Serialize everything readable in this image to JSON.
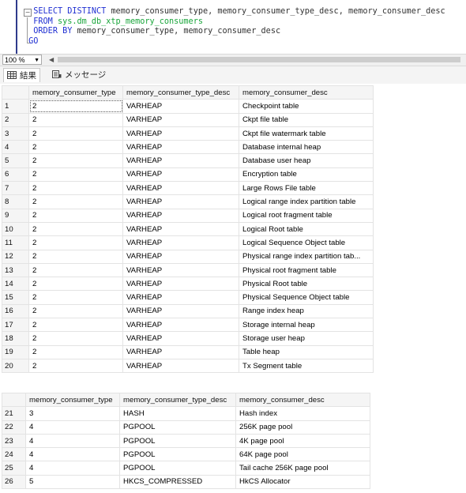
{
  "editor": {
    "line1_kw1": "SELECT DISTINCT ",
    "line1_rest": "memory_consumer_type, memory_consumer_type_desc, memory_consumer_desc",
    "line2_kw": "FROM ",
    "line2_sys": "sys.dm_db_xtp_memory_consumers",
    "line3_kw": "ORDER BY ",
    "line3_rest": "memory_consumer_type, memory_consumer_desc",
    "line4_kw": "GO"
  },
  "zoom": {
    "value": "100 %"
  },
  "tabs": [
    {
      "label": "結果",
      "icon": "grid-icon"
    },
    {
      "label": "メッセージ",
      "icon": "messages-icon"
    }
  ],
  "columns": [
    "memory_consumer_type",
    "memory_consumer_type_desc",
    "memory_consumer_desc"
  ],
  "rows_top": [
    [
      "1",
      "2",
      "VARHEAP",
      "Checkpoint table"
    ],
    [
      "2",
      "2",
      "VARHEAP",
      "Ckpt file table"
    ],
    [
      "3",
      "2",
      "VARHEAP",
      "Ckpt file watermark table"
    ],
    [
      "4",
      "2",
      "VARHEAP",
      "Database internal heap"
    ],
    [
      "5",
      "2",
      "VARHEAP",
      "Database user heap"
    ],
    [
      "6",
      "2",
      "VARHEAP",
      "Encryption table"
    ],
    [
      "7",
      "2",
      "VARHEAP",
      "Large Rows File table"
    ],
    [
      "8",
      "2",
      "VARHEAP",
      "Logical range index partition table"
    ],
    [
      "9",
      "2",
      "VARHEAP",
      "Logical root fragment table"
    ],
    [
      "10",
      "2",
      "VARHEAP",
      "Logical Root table"
    ],
    [
      "11",
      "2",
      "VARHEAP",
      "Logical Sequence Object table"
    ],
    [
      "12",
      "2",
      "VARHEAP",
      "Physical range index partition tab..."
    ],
    [
      "13",
      "2",
      "VARHEAP",
      "Physical root fragment table"
    ],
    [
      "14",
      "2",
      "VARHEAP",
      "Physical Root table"
    ],
    [
      "15",
      "2",
      "VARHEAP",
      "Physical Sequence Object table"
    ],
    [
      "16",
      "2",
      "VARHEAP",
      "Range index heap"
    ],
    [
      "17",
      "2",
      "VARHEAP",
      "Storage internal heap"
    ],
    [
      "18",
      "2",
      "VARHEAP",
      "Storage user heap"
    ],
    [
      "19",
      "2",
      "VARHEAP",
      "Table heap"
    ],
    [
      "20",
      "2",
      "VARHEAP",
      "Tx Segment table"
    ]
  ],
  "rows_bottom": [
    [
      "21",
      "3",
      "HASH",
      "Hash index"
    ],
    [
      "22",
      "4",
      "PGPOOL",
      "256K page pool"
    ],
    [
      "23",
      "4",
      "PGPOOL",
      "4K page pool"
    ],
    [
      "24",
      "4",
      "PGPOOL",
      "64K page pool"
    ],
    [
      "25",
      "4",
      "PGPOOL",
      "Tail cache 256K page pool"
    ],
    [
      "26",
      "5",
      "HKCS_COMPRESSED",
      "HkCS Allocator"
    ]
  ]
}
